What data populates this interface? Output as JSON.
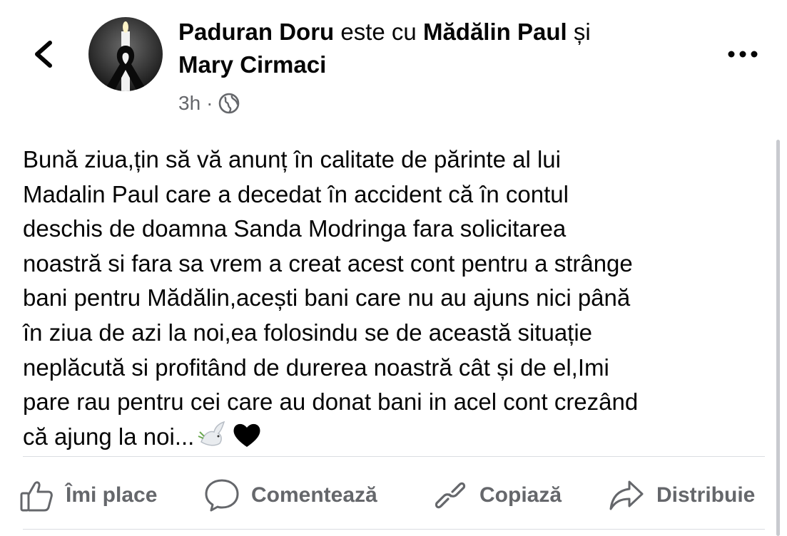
{
  "header": {
    "author": "Paduran Doru",
    "connector": "este cu",
    "tagged_1": "Mădălin Paul",
    "and": "și",
    "tagged_2": "Mary Cirmaci",
    "time": "3h",
    "separator": "·",
    "audience_icon": "globe-icon",
    "back_icon": "chevron-left-icon",
    "more_icon": "more-horizontal-icon"
  },
  "post": {
    "text": "Bună ziua,țin să vă anunț în calitate de părinte al lui\nMadalin Paul care a decedat în accident că în contul\ndeschis de doamna Sanda Modringa fara solicitarea\nnoastră si fara sa vrem a creat acest cont pentru a strânge\nbani pentru Mădălin,acești bani care nu au ajuns nici până\nîn ziua de azi la noi,ea folosindu se de această situație\nneplăcută si profitând de durerea noastră cât și de el,Imi\npare rau pentru cei care au donat bani in acel cont crezând\ncă ajung la noi...",
    "emojis": [
      "dove-emoji",
      "black-heart-emoji"
    ]
  },
  "actions": {
    "like": "Îmi place",
    "comment": "Comentează",
    "copy": "Copiază",
    "share": "Distribuie"
  },
  "colors": {
    "text": "#050505",
    "secondary": "#65676b",
    "divider": "#dadde1"
  }
}
